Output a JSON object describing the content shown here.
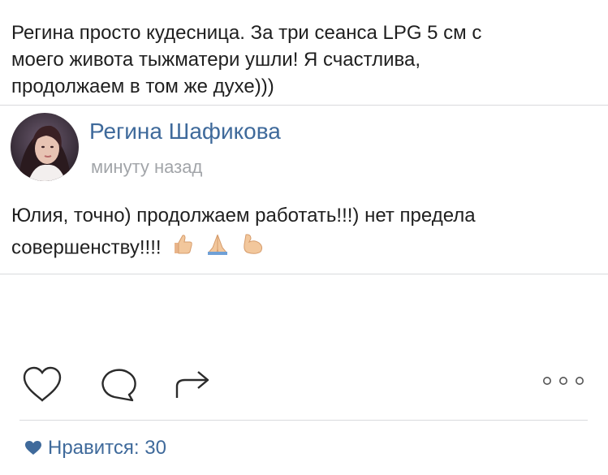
{
  "post": {
    "text": "Регина просто кудесница. За три сеанса LPG 5 см с\nмоего живота тыжматери ушли! Я счастлива,\nпродолжаем в том же духе)))"
  },
  "comment": {
    "author_name": "Регина Шафикова",
    "timestamp": "минуту назад",
    "text_line1": "Юлия, точно) продолжаем работать!!!) нет предела",
    "text_line2": "совершенству!!!!",
    "emojis": [
      "thumbs-up-icon",
      "folded-hands-icon",
      "flexed-biceps-icon"
    ]
  },
  "actions": {
    "icons": [
      "heart-icon",
      "comment-icon",
      "share-icon",
      "more-icon"
    ]
  },
  "likes": {
    "icon": "heart-filled-icon",
    "label": "Нравится: 30"
  },
  "colors": {
    "link_blue": "#3f6a9b",
    "muted_gray": "#a2a5a9",
    "divider": "#d9dadd"
  }
}
